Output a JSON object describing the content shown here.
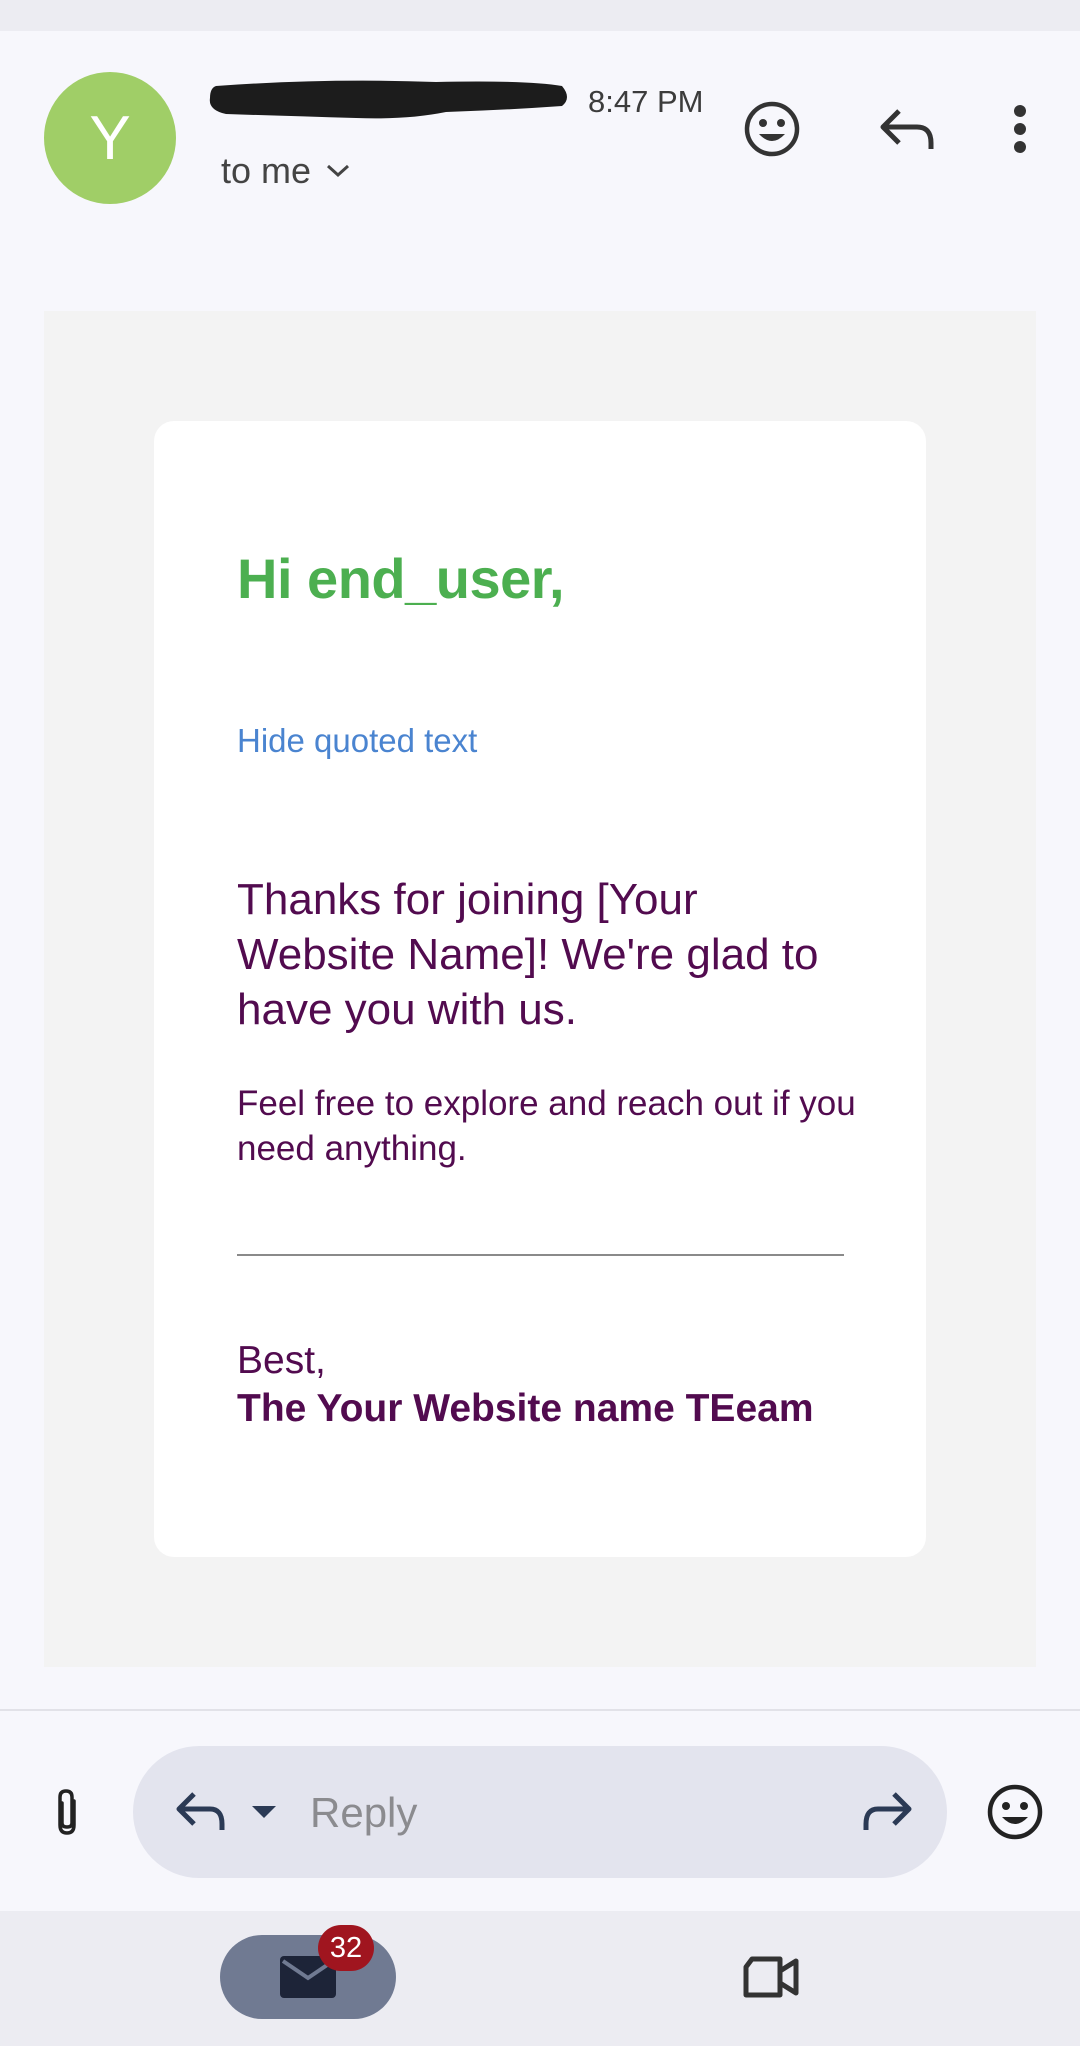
{
  "header": {
    "avatar_letter": "Y",
    "time": "8:47 PM",
    "recipient": "to me"
  },
  "email": {
    "greeting": "Hi end_user,",
    "hide_quoted": "Hide quoted text",
    "paragraph1": "Thanks for joining [Your Website Name]! We're glad to have you with us.",
    "paragraph2": "Feel free to explore and reach out if you need anything.",
    "sign_off": "Best,",
    "signature": "The Your Website name TEeam"
  },
  "reply_bar": {
    "placeholder": "Reply"
  },
  "nav": {
    "mail_badge": "32"
  },
  "icons": [
    "emoji-icon",
    "reply-icon",
    "more-vert-icon",
    "attach-icon",
    "reply-icon",
    "dropdown-icon",
    "forward-icon",
    "emoji-icon",
    "mail-icon",
    "video-icon"
  ],
  "colors": {
    "avatar": "#a0ce67",
    "greeting": "#4caf50",
    "link": "#4a84d0",
    "body_text": "#520b4f",
    "badge": "#a0151f"
  }
}
